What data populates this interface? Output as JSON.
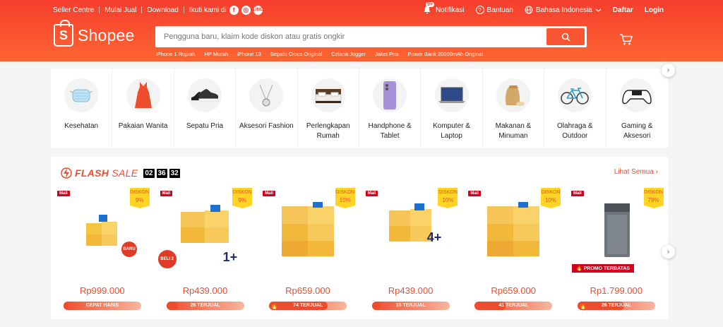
{
  "topbar": {
    "links": [
      "Seller Centre",
      "Mulai Jual",
      "Download"
    ],
    "follow_label": "Ikuti kami di",
    "social_icons": [
      "facebook-icon",
      "instagram-icon",
      "line-icon"
    ],
    "notif_badge": "9+",
    "notifications": "Notifikasi",
    "help": "Bantuan",
    "language": "Bahasa Indonesia",
    "register": "Daftar",
    "login": "Login"
  },
  "brand": {
    "name": "Shopee",
    "logo_letter": "S",
    "color": "#ee4d2d"
  },
  "search": {
    "placeholder": "Pengguna baru, klaim kode diskon atau gratis ongkir",
    "hints": [
      "iPhone 1 Rupiah",
      "HP Murah",
      "iPhone 13",
      "Sepatu Crocs Original",
      "Celana Jogger",
      "Jaket Pria",
      "Power Bank 20000mAh Original"
    ]
  },
  "categories": [
    {
      "label": "Kesehatan",
      "icon": "mask-icon"
    },
    {
      "label": "Pakaian Wanita",
      "icon": "dress-icon"
    },
    {
      "label": "Sepatu Pria",
      "icon": "sneakers-icon"
    },
    {
      "label": "Aksesori Fashion",
      "icon": "necklace-icon"
    },
    {
      "label": "Perlengkapan Rumah",
      "icon": "bed-icon"
    },
    {
      "label": "Handphone & Tablet",
      "icon": "phone-icon"
    },
    {
      "label": "Komputer & Laptop",
      "icon": "laptop-icon"
    },
    {
      "label": "Makanan & Minuman",
      "icon": "food-sack-icon"
    },
    {
      "label": "Olahraga & Outdoor",
      "icon": "bicycle-icon"
    },
    {
      "label": "Gaming & Aksesori",
      "icon": "gamepad-icon"
    }
  ],
  "flash": {
    "title_bold": "FLASH",
    "title_rest": " SALE",
    "timer": [
      "02",
      "36",
      "32"
    ],
    "see_all": "Lihat Semua",
    "products": [
      {
        "mall": "Mall",
        "disc_label": "DISKON",
        "discount": "9%",
        "price": "Rp999.000",
        "sold": "CEPAT HABIS",
        "fill": 0.05,
        "fire": false,
        "tag": "BARU",
        "promo": ""
      },
      {
        "mall": "Mall",
        "disc_label": "DISKON",
        "discount": "9%",
        "price": "Rp439.000",
        "sold": "26 TERJUAL",
        "fill": 0.15,
        "fire": false,
        "tag": "BELI 2",
        "plus": "1+",
        "promo": ""
      },
      {
        "mall": "Mall",
        "disc_label": "DISKON",
        "discount": "10%",
        "price": "Rp659.000",
        "sold": "74 TERJUAL",
        "fill": 0.75,
        "fire": true,
        "tag": "",
        "promo": ""
      },
      {
        "mall": "Mall",
        "disc_label": "DISKON",
        "discount": "10%",
        "price": "Rp439.000",
        "sold": "15 TERJUAL",
        "fill": 0.1,
        "fire": false,
        "tag": "",
        "plus": "4+",
        "promo": ""
      },
      {
        "mall": "Mall",
        "disc_label": "DISKON",
        "discount": "10%",
        "price": "Rp659.000",
        "sold": "41 TERJUAL",
        "fill": 0.4,
        "fire": false,
        "tag": "",
        "promo": ""
      },
      {
        "mall": "Mall",
        "disc_label": "DISKON",
        "discount": "79%",
        "price": "Rp1.799.000",
        "sold": "26 TERJUAL",
        "fill": 0.6,
        "fire": true,
        "tag": "",
        "promo": "PROMO TERBATAS"
      }
    ]
  }
}
